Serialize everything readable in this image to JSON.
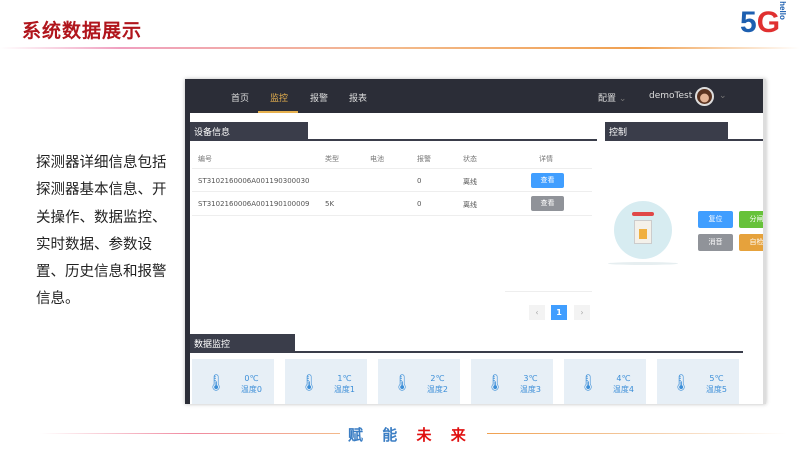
{
  "slide": {
    "title": "系统数据展示",
    "logo": "5G hello",
    "description": "探测器详细信息包括探测器基本信息、开关操作、数据监控、实时数据、参数设置、历史信息和报警信息。",
    "slogan_a": "赋 能",
    "slogan_b": "未 来"
  },
  "nav": {
    "items": [
      "首页",
      "监控",
      "报警",
      "报表"
    ],
    "active": "监控",
    "config": "配置",
    "user": "demoTest"
  },
  "device_info": {
    "title": "设备信息",
    "headers": [
      "编号",
      "类型",
      "电池",
      "报警",
      "状态",
      "详情"
    ],
    "rows": [
      {
        "id": "ST3102160006A001190300030",
        "type": "",
        "battery": "",
        "alarm": "0",
        "status": "离线",
        "action": "查看"
      },
      {
        "id": "ST3102160006A001190100009",
        "type": "5K",
        "battery": "",
        "alarm": "0",
        "status": "离线",
        "action": "查看"
      }
    ],
    "pagination": {
      "prev": "‹",
      "current": "1",
      "next": "›"
    }
  },
  "control": {
    "title": "控制",
    "buttons": [
      {
        "label": "复位",
        "color": "#409eff"
      },
      {
        "label": "分闸",
        "color": "#67c23a"
      },
      {
        "label": "消音",
        "color": "#909399"
      },
      {
        "label": "自检",
        "color": "#e6a23c"
      }
    ]
  },
  "data_monitor": {
    "title": "数据监控",
    "cards": [
      {
        "value": "0℃",
        "label": "温度0"
      },
      {
        "value": "1℃",
        "label": "温度1"
      },
      {
        "value": "2℃",
        "label": "温度2"
      },
      {
        "value": "3℃",
        "label": "温度3"
      },
      {
        "value": "4℃",
        "label": "温度4"
      },
      {
        "value": "5℃",
        "label": "温度5"
      }
    ]
  },
  "colors": {
    "title": "#b0151c",
    "nav": "#2b2d37",
    "accent": "#e6b04e",
    "primary": "#409eff"
  }
}
